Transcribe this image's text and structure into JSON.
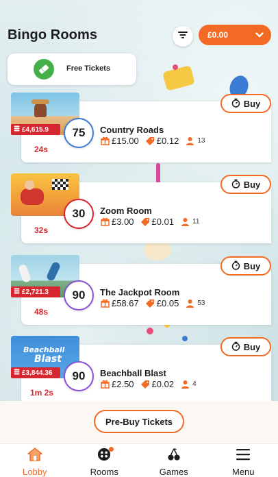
{
  "header": {
    "title": "Bingo Rooms",
    "balance": "£0.00"
  },
  "free_tickets": {
    "label": "Free Tickets"
  },
  "rooms": [
    {
      "name": "Country Roads",
      "ball_number": "75",
      "ticket_price": "£15.00",
      "pattern_price": "£0.12",
      "players": "13",
      "timer": "24s",
      "jackpot": "£4,615.9",
      "ball_color": "#3a7bd5"
    },
    {
      "name": "Zoom Room",
      "ball_number": "30",
      "ticket_price": "£3.00",
      "pattern_price": "£0.01",
      "players": "11",
      "timer": "32s",
      "jackpot": "",
      "ball_color": "#d7262f"
    },
    {
      "name": "The Jackpot Room",
      "ball_number": "90",
      "ticket_price": "£58.67",
      "pattern_price": "£0.05",
      "players": "53",
      "timer": "48s",
      "jackpot": "£2,721.3",
      "ball_color": "#8a4fd8"
    },
    {
      "name": "Beachball Blast",
      "ball_number": "90",
      "ticket_price": "£2.50",
      "pattern_price": "£0.02",
      "players": "4",
      "timer": "1m 2s",
      "jackpot": "£3,844.36",
      "ball_color": "#8a4fd8",
      "thumb_text_1": "Beachball",
      "thumb_text_2": "Blast"
    }
  ],
  "buy_label": "Buy",
  "prebuy_label": "Pre-Buy Tickets",
  "tabs": [
    {
      "label": "Lobby",
      "icon": "home-icon",
      "active": true
    },
    {
      "label": "Rooms",
      "icon": "bingo-ball-icon",
      "active": false
    },
    {
      "label": "Games",
      "icon": "cherries-icon",
      "active": false
    },
    {
      "label": "Menu",
      "icon": "menu-icon",
      "active": false
    }
  ],
  "colors": {
    "accent": "#f26a24",
    "jackpot": "#d7262f",
    "timer": "#d7262f",
    "free_ticket_green": "#45b04a"
  }
}
